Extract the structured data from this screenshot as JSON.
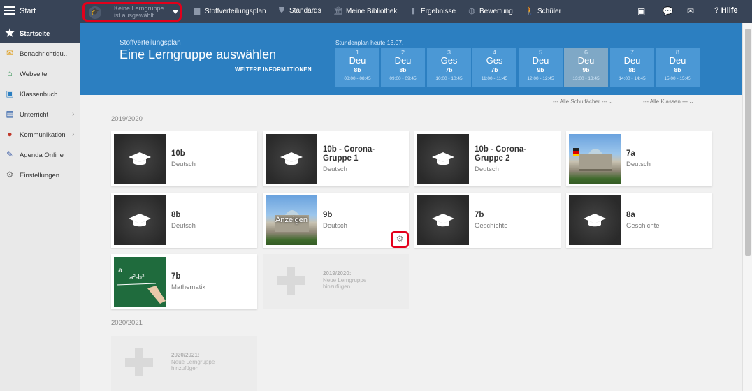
{
  "topbar": {
    "start_label": "Start",
    "group_select_line1": "Keine Lerngruppe",
    "group_select_line2": "ist ausgewählt",
    "nav": [
      "Stoffverteilungsplan",
      "Standards",
      "Meine Bibliothek",
      "Ergebnisse",
      "Bewertung",
      "Schüler"
    ],
    "help_label": "Hilfe"
  },
  "sidebar": {
    "items": [
      {
        "label": "Startseite",
        "icon": "star-icon"
      },
      {
        "label": "Benachrichtigu...",
        "icon": "envelope-icon"
      },
      {
        "label": "Webseite",
        "icon": "home-icon"
      },
      {
        "label": "Klassenbuch",
        "icon": "book-icon"
      },
      {
        "label": "Unterricht",
        "icon": "board-icon"
      },
      {
        "label": "Kommunikation",
        "icon": "chat-icon"
      },
      {
        "label": "Agenda Online",
        "icon": "pen-icon"
      },
      {
        "label": "Einstellungen",
        "icon": "gear-icon"
      }
    ]
  },
  "hero": {
    "kicker": "Stoffverteilungsplan",
    "title": "Eine Lerngruppe auswählen",
    "more": "WEITERE INFORMATIONEN",
    "schedule_title": "Stundenplan heute 13.07.",
    "slots": [
      {
        "n": "1",
        "subject": "Deu",
        "class": "8b",
        "time": "08:00 - 08:45"
      },
      {
        "n": "2",
        "subject": "Deu",
        "class": "8b",
        "time": "09:00 - 09:45"
      },
      {
        "n": "3",
        "subject": "Ges",
        "class": "7b",
        "time": "10:00 - 10:45"
      },
      {
        "n": "4",
        "subject": "Ges",
        "class": "7b",
        "time": "11:00 - 11:45"
      },
      {
        "n": "5",
        "subject": "Deu",
        "class": "9b",
        "time": "12:00 - 12:45"
      },
      {
        "n": "6",
        "subject": "Deu",
        "class": "9b",
        "time": "13:00 - 13:45"
      },
      {
        "n": "7",
        "subject": "Deu",
        "class": "8b",
        "time": "14:00 - 14:45"
      },
      {
        "n": "8",
        "subject": "Deu",
        "class": "8b",
        "time": "15:00 - 15:45"
      }
    ]
  },
  "filters": {
    "subjects": "--- Alle Schulfächer ---",
    "classes": "--- Alle Klassen ---"
  },
  "years": [
    "2019/2020",
    "2020/2021"
  ],
  "cards": [
    {
      "name": "10b",
      "subject": "Deutsch"
    },
    {
      "name": "10b - Corona-",
      "name2": "Gruppe 1",
      "subject": "Deutsch"
    },
    {
      "name": "10b - Corona-",
      "name2": "Gruppe 2",
      "subject": "Deutsch"
    },
    {
      "name": "7a",
      "subject": "Deutsch"
    },
    {
      "name": "8b",
      "subject": "Deutsch"
    },
    {
      "name": "9b",
      "subject": "Deutsch",
      "overlay": "Anzeigen"
    },
    {
      "name": "7b",
      "subject": "Geschichte"
    },
    {
      "name": "8a",
      "subject": "Geschichte"
    },
    {
      "name": "7b",
      "subject": "Mathematik"
    }
  ],
  "add": [
    {
      "line1": "2019/2020:",
      "line2": "Neue Lerngruppe",
      "line3": "hinzufügen"
    },
    {
      "line1": "2020/2021:",
      "line2": "Neue Lerngruppe",
      "line3": "hinzufügen"
    }
  ]
}
